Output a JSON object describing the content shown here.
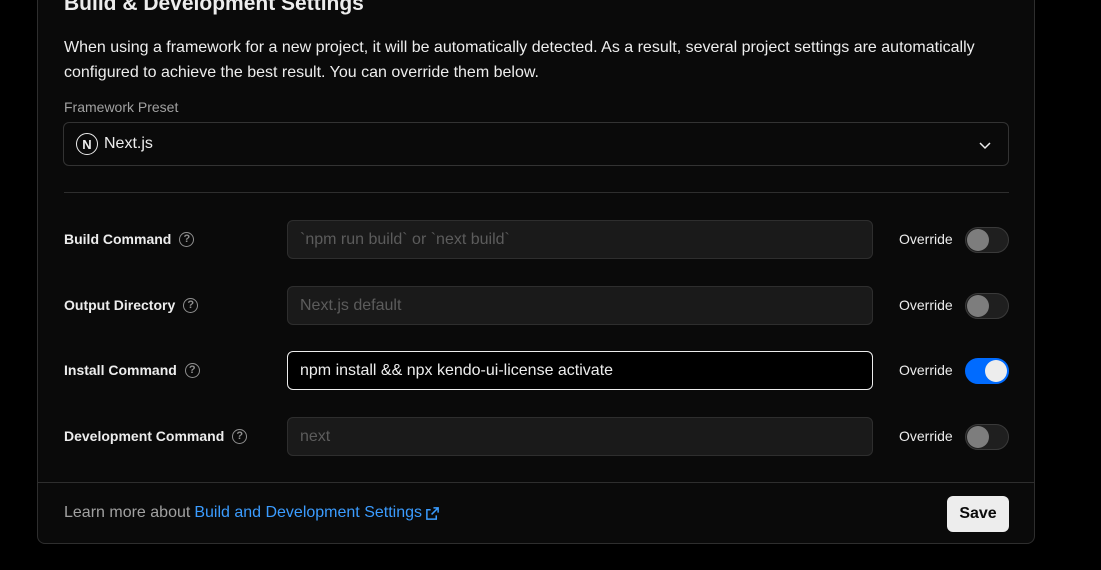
{
  "section": {
    "title": "Build & Development Settings",
    "description": "When using a framework for a new project, it will be automatically detected. As a result, several project settings are automatically configured to achieve the best result. You can override them below."
  },
  "framework": {
    "label": "Framework Preset",
    "logo_letter": "N",
    "selected": "Next.js"
  },
  "rows": [
    {
      "label": "Build Command",
      "value": "",
      "placeholder": "`npm run build` or `next build`",
      "override_label": "Override",
      "override_on": false
    },
    {
      "label": "Output Directory",
      "value": "",
      "placeholder": "Next.js default",
      "override_label": "Override",
      "override_on": false
    },
    {
      "label": "Install Command",
      "value": "npm install && npx kendo-ui-license activate",
      "placeholder": "",
      "override_label": "Override",
      "override_on": true
    },
    {
      "label": "Development Command",
      "value": "",
      "placeholder": "next",
      "override_label": "Override",
      "override_on": false
    }
  ],
  "help_glyph": "?",
  "footer": {
    "prefix": "Learn more about",
    "link_text": "Build and Development Settings",
    "save_label": "Save"
  },
  "colors": {
    "accent": "#006bff",
    "link": "#3b9cff"
  }
}
